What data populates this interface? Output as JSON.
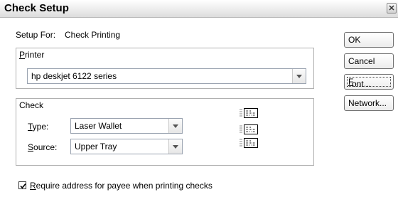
{
  "dialog": {
    "title": "Check Setup",
    "setup_for_label": "Setup For:",
    "setup_for_value": "Check Printing"
  },
  "printer": {
    "group_label_first": "P",
    "group_label_rest": "rinter",
    "selected": "hp deskjet 6122 series"
  },
  "check": {
    "group_label": "Check",
    "type_label_first": "T",
    "type_label_rest": "ype:",
    "type_value": "Laser Wallet",
    "source_label_first": "S",
    "source_label_rest": "ource:",
    "source_value": "Upper Tray"
  },
  "buttons": {
    "ok": "OK",
    "cancel": "Cancel",
    "font_first": "F",
    "font_rest": "ont...",
    "network": "Network..."
  },
  "require_address": {
    "checked": true,
    "label_first": "R",
    "label_rest": "equire address for payee when printing checks"
  },
  "icons": {
    "close": "close-icon",
    "check_layout": "check-layout-icon"
  }
}
